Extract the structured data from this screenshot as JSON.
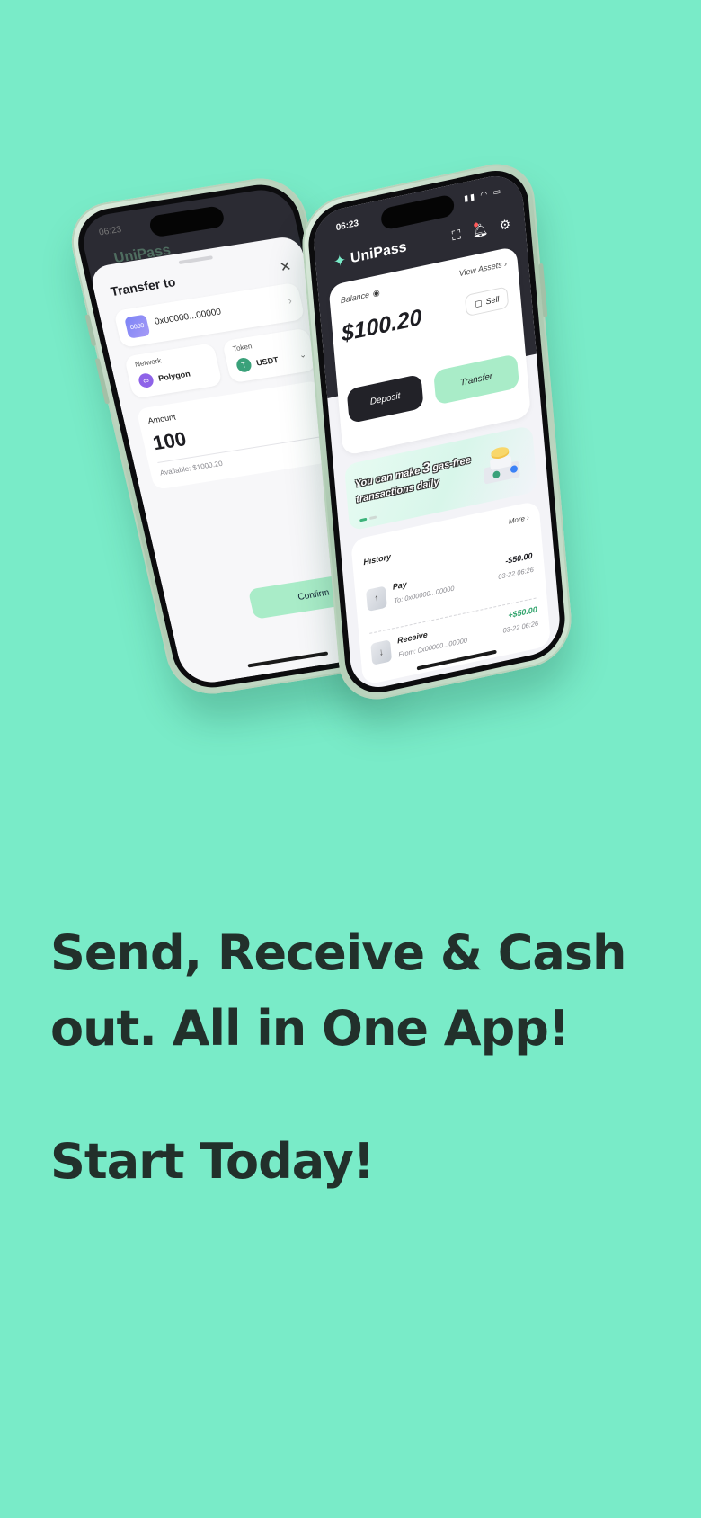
{
  "transfer_screen": {
    "status_time": "06:23",
    "brand": "UniPass",
    "title": "Transfer to",
    "recipient_avatar": "0000",
    "recipient_address": "0x00000...00000",
    "network_label": "Network",
    "network_value": "Polygon",
    "token_label": "Token",
    "token_value": "USDT",
    "amount_label": "Amount",
    "amount_value": "100",
    "available_text": "Available: $1000.20",
    "confirm_label": "Confirm"
  },
  "wallet_screen": {
    "status_time": "06:23",
    "brand": "UniPass",
    "balance_label": "Balance",
    "view_assets_label": "View Assets",
    "balance_value": "$100.20",
    "sell_label": "Sell",
    "deposit_label": "Deposit",
    "transfer_label": "Transfer",
    "banner_text_prefix": "You can make ",
    "banner_number": "3",
    "banner_text_suffix": " gas-free transactions daily",
    "history_title": "History",
    "more_label": "More",
    "transactions": [
      {
        "type": "Pay",
        "address": "To: 0x00000...00000",
        "amount": "-$50.00",
        "time": "03-22 06:26",
        "amount_color": "#1d1d22",
        "icon": "pay-icon"
      },
      {
        "type": "Receive",
        "address": "From: 0x00000...00000",
        "amount": "+$50.00",
        "time": "03-22 06:26",
        "amount_color": "#2fa36b",
        "icon": "receive-icon"
      }
    ]
  },
  "headline": {
    "line1": "Send, Receive & Cash",
    "line2": "out. All in One App!",
    "cta": "Start Today!"
  },
  "colors": {
    "background": "#79ebc8",
    "accent": "#a9ecc8",
    "dark": "#2b2b33",
    "text": "#22302b"
  }
}
